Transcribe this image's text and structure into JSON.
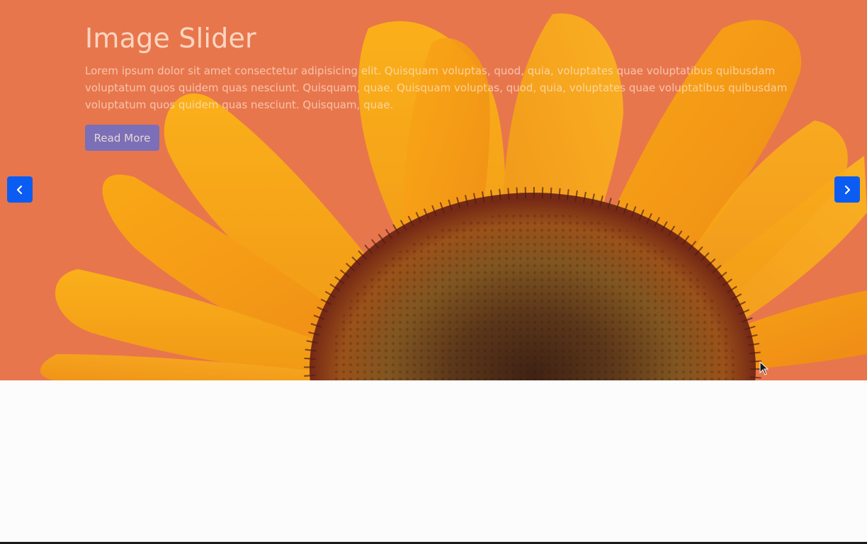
{
  "slider": {
    "title": "Image Slider",
    "description": "Lorem ipsum dolor sit amet consectetur adipisicing elit. Quisquam voluptas, quod, quia, voluptates quae voluptatibus quibusdam voluptatum quos quidem quas nesciunt. Quisquam, quae. Quisquam voluptas, quod, quia, voluptates quae voluptatibus quibusdam voluptatum quos quidem quas nesciunt. Quisquam, quae.",
    "read_more_label": "Read More",
    "prev_icon": "chevron-left-icon",
    "next_icon": "chevron-right-icon",
    "background_image": "sunflower-photo"
  },
  "colors": {
    "slide_background": "#e8784e",
    "nav_button": "#0b5cf2",
    "read_more_button": "#5c6ed6",
    "page_background": "#fcfcfd"
  }
}
